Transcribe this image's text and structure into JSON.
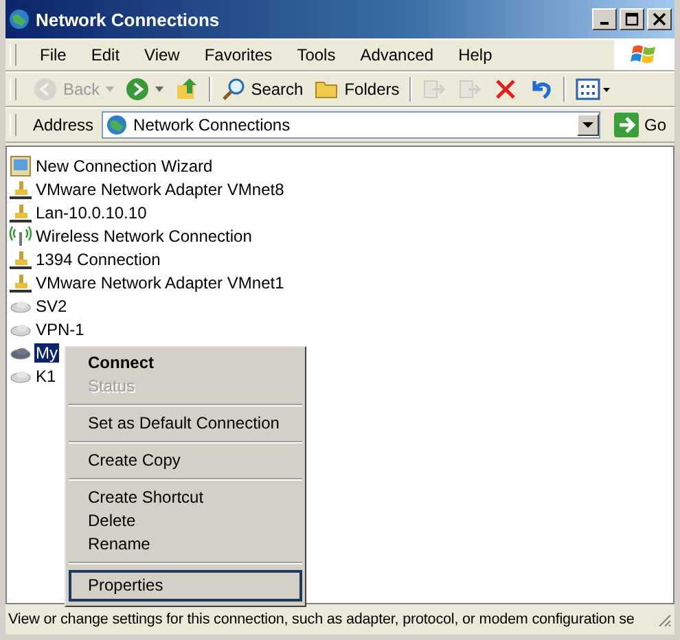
{
  "window": {
    "title": "Network Connections"
  },
  "menu_bar": [
    {
      "label": "File"
    },
    {
      "label": "Edit"
    },
    {
      "label": "View"
    },
    {
      "label": "Favorites"
    },
    {
      "label": "Tools"
    },
    {
      "label": "Advanced"
    },
    {
      "label": "Help"
    }
  ],
  "toolbar": [
    {
      "kind": "back",
      "label": "Back",
      "disabled": true
    },
    {
      "kind": "forward",
      "disabled": false
    },
    {
      "kind": "up",
      "disabled": false
    },
    {
      "kind": "separator"
    },
    {
      "kind": "search",
      "label": "Search",
      "disabled": false
    },
    {
      "kind": "folders",
      "label": "Folders",
      "disabled": false
    },
    {
      "kind": "separator"
    },
    {
      "kind": "move",
      "disabled": true
    },
    {
      "kind": "copy",
      "disabled": true
    },
    {
      "kind": "delete",
      "disabled": false
    },
    {
      "kind": "undo",
      "disabled": false
    },
    {
      "kind": "separator"
    },
    {
      "kind": "views",
      "disabled": false
    }
  ],
  "address_bar": {
    "label": "Address",
    "value": "Network Connections",
    "go": "Go"
  },
  "connections": [
    {
      "name": "New Connection Wizard",
      "kind": "wizard",
      "selected": false
    },
    {
      "name": "VMware Network Adapter VMnet8",
      "kind": "wired",
      "selected": false
    },
    {
      "name": "Lan-10.0.10.10",
      "kind": "wired",
      "selected": false
    },
    {
      "name": "Wireless Network Connection",
      "kind": "wireless",
      "selected": false
    },
    {
      "name": "1394 Connection",
      "kind": "wired",
      "selected": false
    },
    {
      "name": "VMware Network Adapter VMnet1",
      "kind": "wired",
      "selected": false
    },
    {
      "name": "SV2",
      "kind": "vpn",
      "selected": false
    },
    {
      "name": "VPN-1",
      "kind": "vpn",
      "selected": false
    },
    {
      "name": "My",
      "kind": "vpn",
      "selected": true
    },
    {
      "name": "K1",
      "kind": "vpn",
      "selected": false
    }
  ],
  "context_menu": [
    {
      "kind": "item",
      "label": "Connect",
      "default": true,
      "disabled": false,
      "focused": false
    },
    {
      "kind": "item",
      "label": "Status",
      "default": false,
      "disabled": true,
      "focused": false
    },
    {
      "kind": "separator"
    },
    {
      "kind": "item",
      "label": "Set as Default Connection",
      "default": false,
      "disabled": false,
      "focused": false
    },
    {
      "kind": "separator"
    },
    {
      "kind": "item",
      "label": "Create Copy",
      "default": false,
      "disabled": false,
      "focused": false
    },
    {
      "kind": "separator"
    },
    {
      "kind": "item",
      "label": "Create Shortcut",
      "default": false,
      "disabled": false,
      "focused": false
    },
    {
      "kind": "item",
      "label": "Delete",
      "default": false,
      "disabled": false,
      "focused": false
    },
    {
      "kind": "item",
      "label": "Rename",
      "default": false,
      "disabled": false,
      "focused": false
    },
    {
      "kind": "separator"
    },
    {
      "kind": "item",
      "label": "Properties",
      "default": false,
      "disabled": false,
      "focused": true
    }
  ],
  "status_bar": "View or change settings for this connection, such as adapter, protocol, or modem configuration se"
}
